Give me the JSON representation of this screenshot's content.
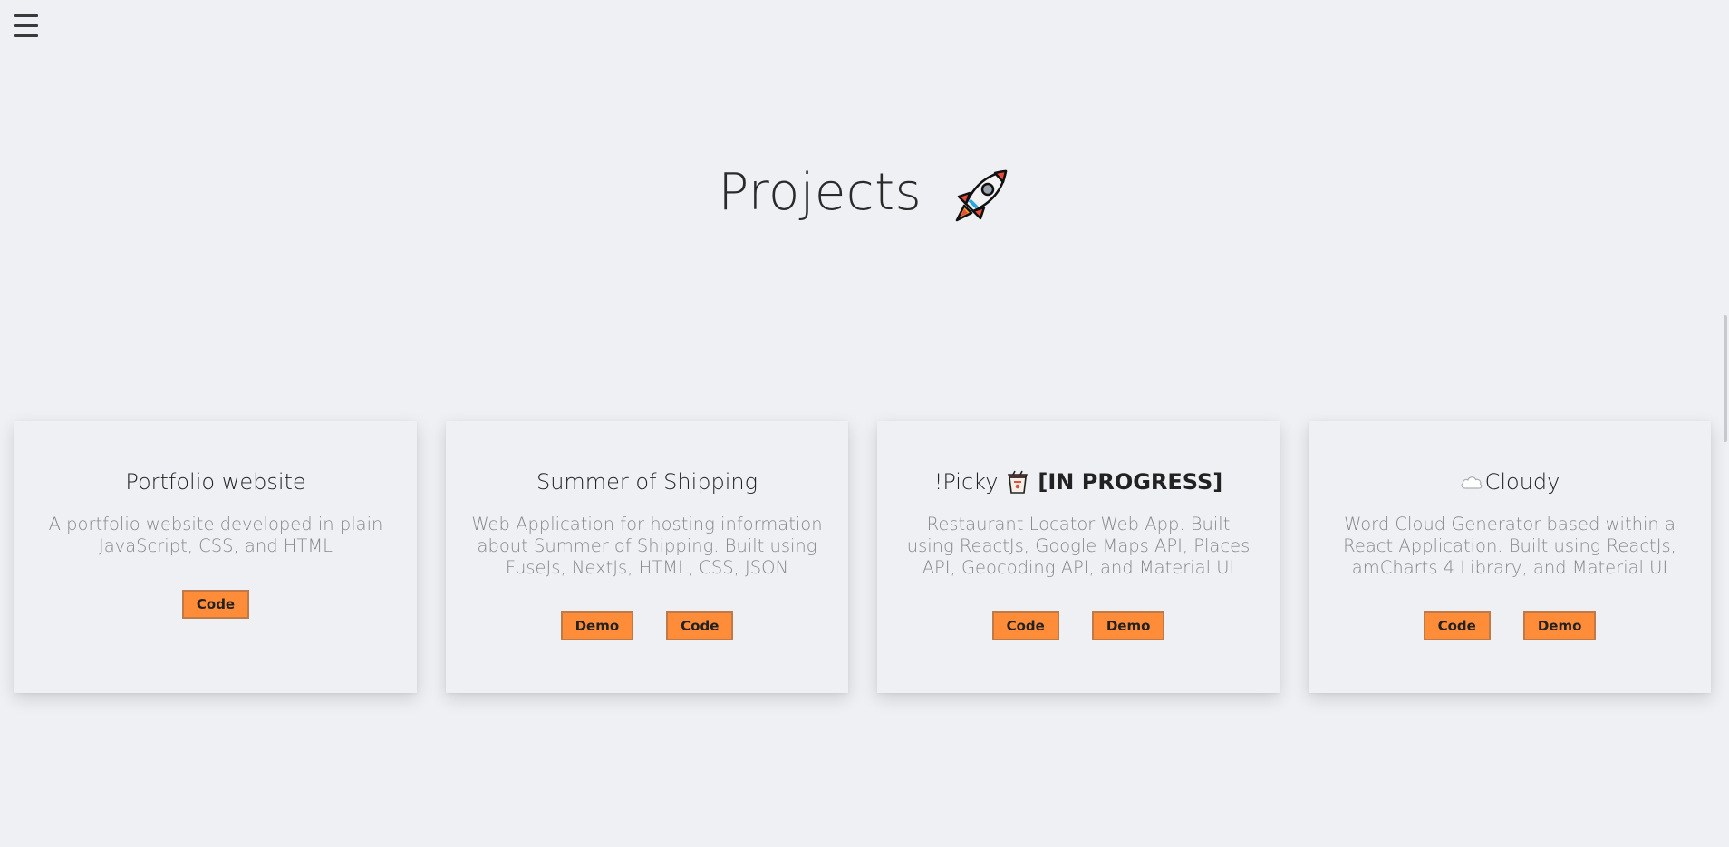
{
  "header": {
    "menu_icon": "hamburger-menu-icon"
  },
  "section": {
    "title": "Projects",
    "title_icon": "rocket-icon"
  },
  "projects": [
    {
      "title": "Portfolio website",
      "description": "A portfolio website developed in plain JavaScript, CSS, and HTML",
      "buttons": [
        "Code"
      ]
    },
    {
      "title": "Summer of Shipping",
      "description": "Web Application for hosting information about Summer of Shipping. Built using FuseJs, NextJs, HTML, CSS, JSON",
      "buttons": [
        "Demo",
        "Code"
      ]
    },
    {
      "title": "!Picky",
      "title_icon": "takeout-box-icon",
      "title_suffix": "[IN PROGRESS]",
      "description": "Restaurant Locator Web App. Built using ReactJs, Google Maps API, Places API, Geocoding API, and Material UI",
      "buttons": [
        "Code",
        "Demo"
      ]
    },
    {
      "title": "Cloudy",
      "title_icon": "cloud-icon",
      "description": "Word Cloud Generator based within a React Application. Built using ReactJs, amCharts 4 Library, and Material UI",
      "buttons": [
        "Code",
        "Demo"
      ]
    }
  ],
  "colors": {
    "background": "#eef0f4",
    "button": "#ff8c38",
    "button_border": "#bf7a4a"
  }
}
